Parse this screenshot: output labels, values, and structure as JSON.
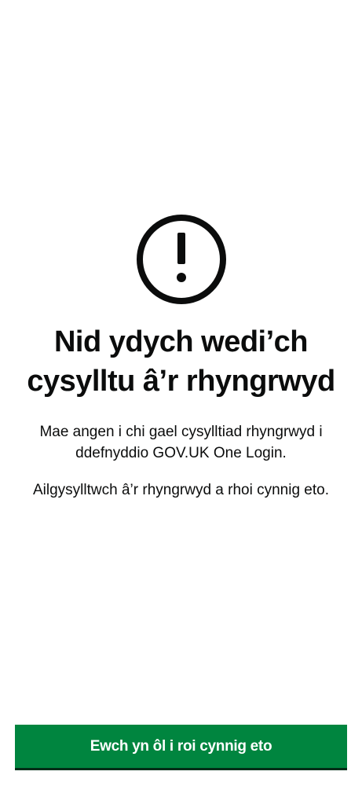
{
  "error_screen": {
    "icon": "exclamation-circle-icon",
    "title": "Nid ydych wedi’ch cysylltu â’r rhyngrwyd",
    "body_1": "Mae angen i chi gael cysylltiad rhyngrwyd i ddefnyddio GOV.UK One Login.",
    "body_2": "Ailgysylltwch â’r rhyngrwyd a rhoi cynnig eto."
  },
  "actions": {
    "retry_label": "Ewch yn ôl i roi cynnig eto"
  },
  "colors": {
    "button_green": "#00853f",
    "text": "#0b0c0c",
    "background": "#ffffff"
  }
}
